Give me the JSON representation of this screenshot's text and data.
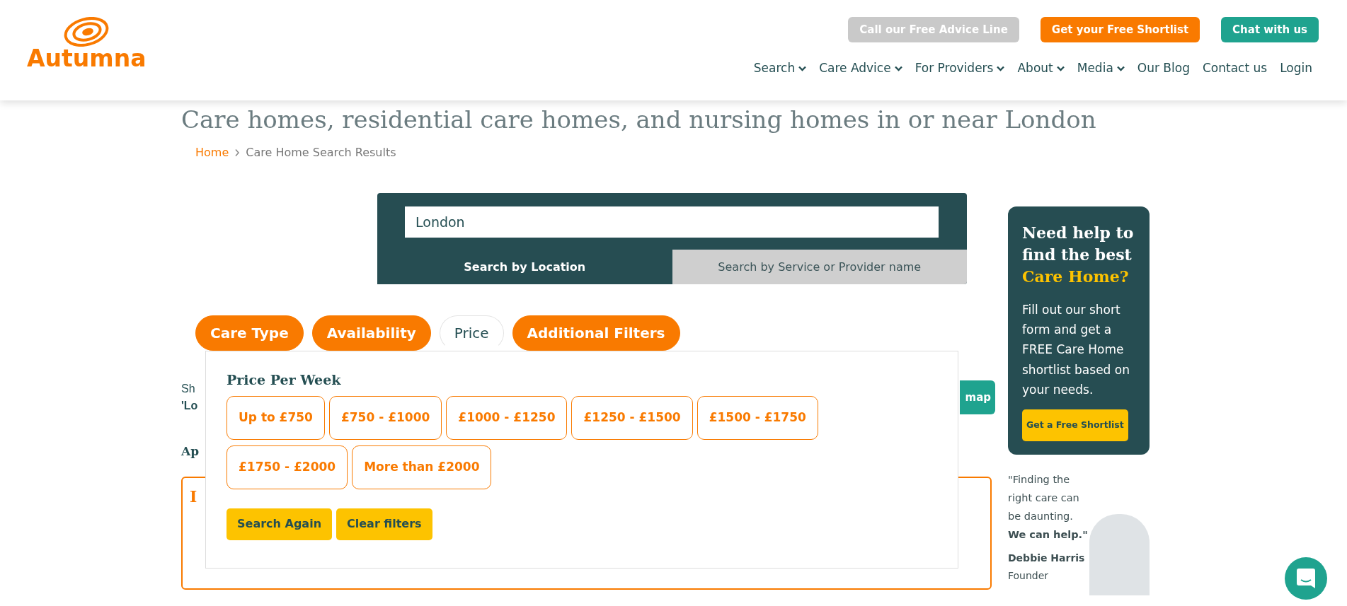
{
  "header": {
    "logo_text": "Autumna",
    "top_buttons": [
      {
        "label": "Call our Free Advice Line",
        "kind": "grey"
      },
      {
        "label": "Get your Free Shortlist",
        "kind": "orange"
      },
      {
        "label": "Chat with us",
        "kind": "teal"
      }
    ],
    "nav": [
      {
        "label": "Search",
        "dropdown": true
      },
      {
        "label": "Care Advice",
        "dropdown": true
      },
      {
        "label": "For Providers",
        "dropdown": true
      },
      {
        "label": "About",
        "dropdown": true
      },
      {
        "label": "Media",
        "dropdown": true
      },
      {
        "label": "Our Blog",
        "dropdown": false
      },
      {
        "label": "Contact us",
        "dropdown": false
      },
      {
        "label": "Login",
        "dropdown": false
      }
    ]
  },
  "page_title": "Care homes, residential care homes, and nursing homes in or near London",
  "breadcrumb": [
    {
      "label": "Home",
      "link": true
    },
    {
      "label": "Care Home Search Results",
      "link": false
    }
  ],
  "search": {
    "value": "London",
    "tabs": [
      {
        "label": "Search by Location",
        "selected": true
      },
      {
        "label": "Search by Service or Provider name",
        "selected": false
      }
    ]
  },
  "filters": [
    {
      "label": "Care Type",
      "selected": false
    },
    {
      "label": "Availability",
      "selected": false
    },
    {
      "label": "Price",
      "selected": true
    },
    {
      "label": "Additional Filters",
      "selected": false
    }
  ],
  "price_panel": {
    "title": "Price Per Week",
    "options": [
      {
        "label": "Up to £750",
        "selected": false
      },
      {
        "label": "£750 - £1000",
        "selected": false
      },
      {
        "label": "£1000 - £1250",
        "selected": false
      },
      {
        "label": "£1250 - £1500",
        "selected": false
      },
      {
        "label": "£1500 - £1750",
        "selected": false
      },
      {
        "label": "£1750 - £2000",
        "selected": false
      },
      {
        "label": "More than £2000",
        "selected": false
      }
    ],
    "buttons": [
      "Search Again",
      "Clear filters"
    ]
  },
  "results": {
    "summary_line_1": "Sh",
    "summary_line_2": "'Lo",
    "map_button": "map",
    "subheading": "Ap",
    "card_title": "I"
  },
  "sidebar": {
    "heading": "Need help to find the best",
    "heading_highlight": "Care Home?",
    "body": "Fill out our short form and get a FREE Care Home shortlist based on your needs.",
    "button": "Get a Free Shortlist",
    "quote": "\"Finding the right care can be daunting. **We can help.\"**",
    "name": "Debbie Harris",
    "role": "Founder"
  }
}
